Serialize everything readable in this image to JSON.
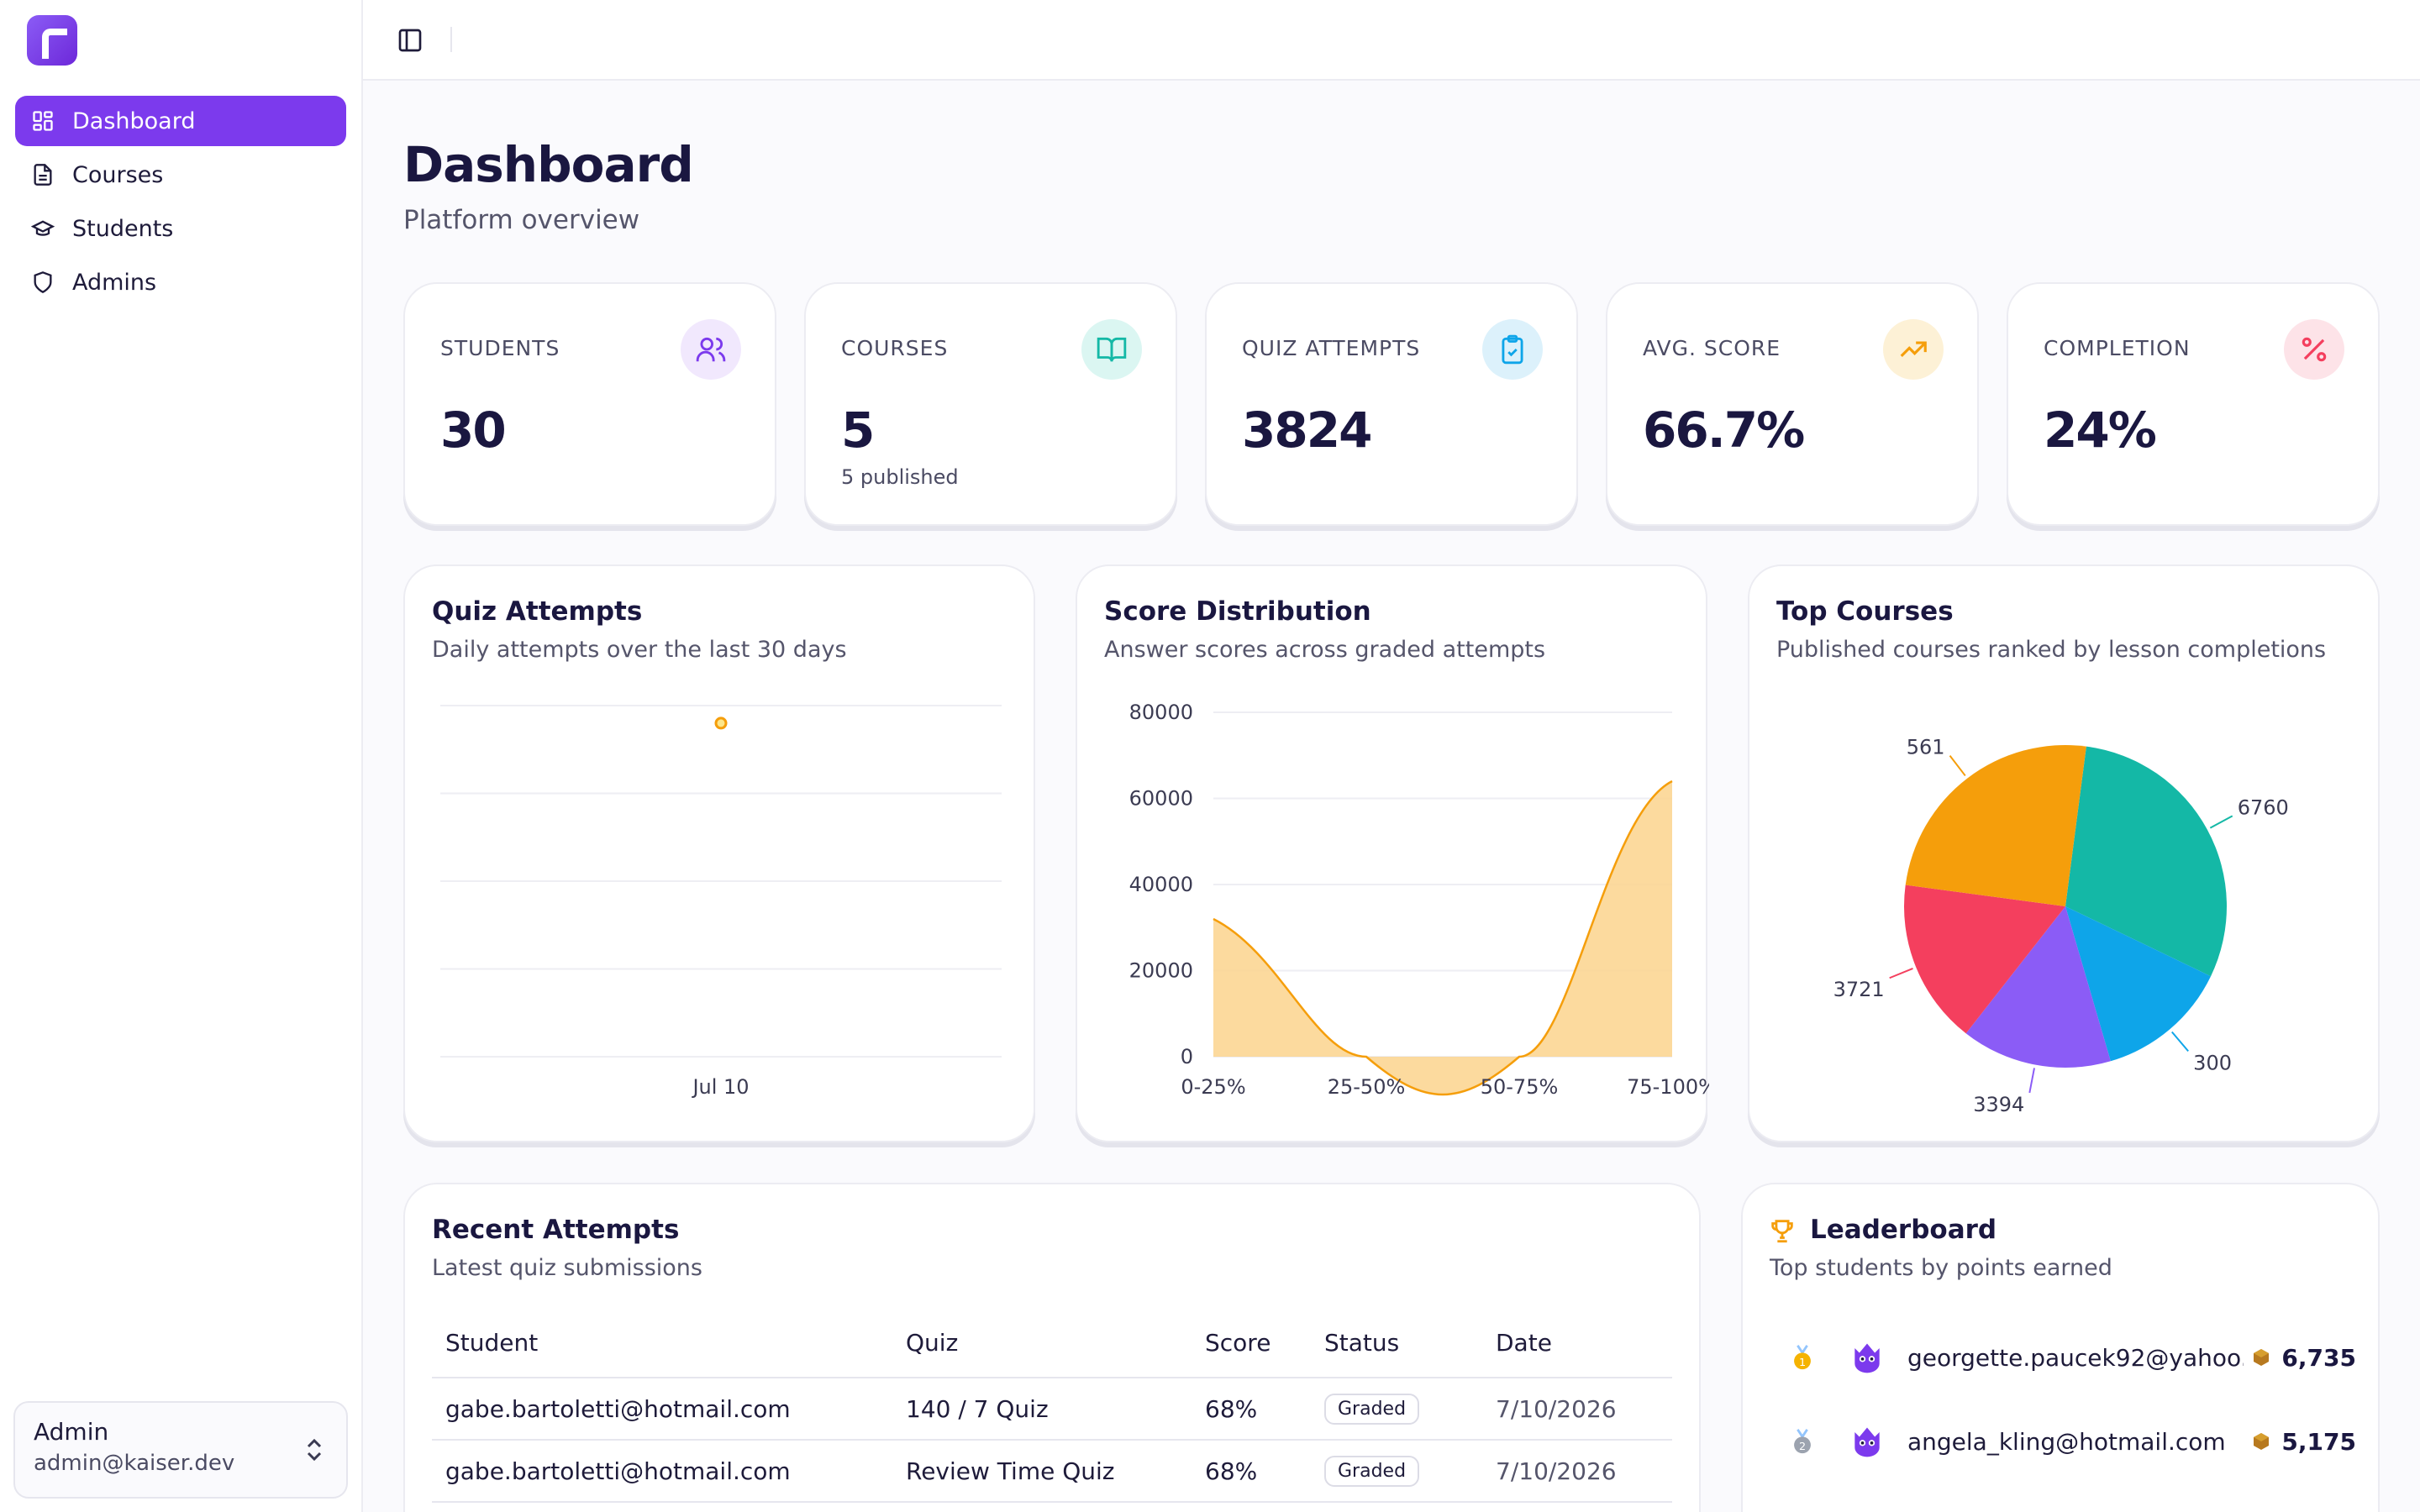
{
  "sidebar": {
    "items": [
      {
        "label": "Dashboard",
        "icon": "layout-grid-icon",
        "active": true
      },
      {
        "label": "Courses",
        "icon": "file-text-icon"
      },
      {
        "label": "Students",
        "icon": "graduation-cap-icon"
      },
      {
        "label": "Admins",
        "icon": "shield-icon"
      }
    ],
    "user": {
      "name": "Admin",
      "email": "admin@kaiser.dev"
    }
  },
  "page": {
    "title": "Dashboard",
    "subtitle": "Platform overview"
  },
  "stats": [
    {
      "label": "STUDENTS",
      "value": "30",
      "sub": "",
      "icon": "users-icon",
      "color": "#7c3aed",
      "bg": "#f1e8fd"
    },
    {
      "label": "COURSES",
      "value": "5",
      "sub": "5 published",
      "icon": "book-open-icon",
      "color": "#14b8a6",
      "bg": "#dbf6f2"
    },
    {
      "label": "QUIZ ATTEMPTS",
      "value": "3824",
      "sub": "",
      "icon": "clipboard-check-icon",
      "color": "#0ea5e9",
      "bg": "#dcf1fb"
    },
    {
      "label": "AVG. SCORE",
      "value": "66.7%",
      "sub": "",
      "icon": "trending-up-icon",
      "color": "#f59e0b",
      "bg": "#fdf1d6"
    },
    {
      "label": "COMPLETION",
      "value": "24%",
      "sub": "",
      "icon": "percent-icon",
      "color": "#f43f5e",
      "bg": "#fde3e8"
    }
  ],
  "quiz_chart": {
    "title": "Quiz Attempts",
    "desc": "Daily attempts over the last 30 days"
  },
  "score_chart": {
    "title": "Score Distribution",
    "desc": "Answer scores across graded attempts"
  },
  "courses_chart": {
    "title": "Top Courses",
    "desc": "Published courses ranked by lesson completions"
  },
  "chart_data": [
    {
      "type": "line",
      "title": "Quiz Attempts",
      "categories": [
        "Jul 10"
      ],
      "series": [
        {
          "values": [
            3824
          ]
        }
      ],
      "grid": true,
      "color": "#f59e0b"
    },
    {
      "type": "area",
      "title": "Score Distribution",
      "categories": [
        "0-25%",
        "25-50%",
        "50-75%",
        "75-100%"
      ],
      "series": [
        {
          "values": [
            32000,
            0,
            0,
            64000
          ]
        }
      ],
      "ylim": [
        0,
        80000
      ],
      "yticks": [
        0,
        20000,
        40000,
        60000,
        80000
      ],
      "grid": true,
      "color": "#f59e0b"
    },
    {
      "type": "pie",
      "title": "Top Courses",
      "slices": [
        {
          "value": 6760,
          "label": "6760",
          "color": "#14b8a6"
        },
        {
          "value": 3000,
          "label": "300",
          "color": "#0ea5e9"
        },
        {
          "value": 3394,
          "label": "3394",
          "color": "#8b5cf6"
        },
        {
          "value": 3721,
          "label": "3721",
          "color": "#f43f5e"
        },
        {
          "value": 5610,
          "label": "561",
          "color": "#f59e0b"
        }
      ]
    }
  ],
  "recent": {
    "title": "Recent Attempts",
    "desc": "Latest quiz submissions",
    "columns": [
      "Student",
      "Quiz",
      "Score",
      "Status",
      "Date"
    ],
    "rows": [
      {
        "student": "gabe.bartoletti@hotmail.com",
        "quiz": "140 / 7 Quiz",
        "score": "68%",
        "status": "Graded",
        "date": "7/10/2026"
      },
      {
        "student": "gabe.bartoletti@hotmail.com",
        "quiz": "Review Time Quiz",
        "score": "68%",
        "status": "Graded",
        "date": "7/10/2026"
      }
    ]
  },
  "leaderboard": {
    "title": "Leaderboard",
    "desc": "Top students by points earned",
    "rows": [
      {
        "email": "georgette.paucek92@yahoo....",
        "points": "6,735",
        "medal_color": "#f5b301"
      },
      {
        "email": "angela_kling@hotmail.com",
        "points": "5,175",
        "medal_color": "#9ca3af"
      }
    ]
  }
}
